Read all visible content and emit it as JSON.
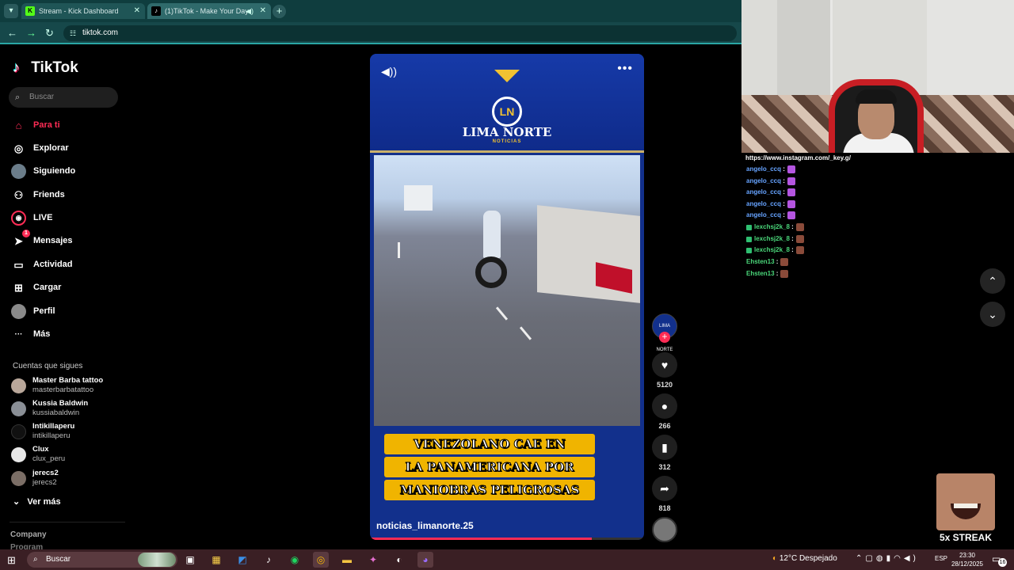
{
  "browser": {
    "tabs": [
      {
        "label": "Stream - Kick Dashboard",
        "favicon": "K"
      },
      {
        "label": "(1)TikTok - Make Your Day",
        "favicon": "♪"
      }
    ],
    "url": "tiktok.com"
  },
  "tiktok": {
    "logo": "TikTok",
    "search_placeholder": "Buscar",
    "nav": [
      {
        "label": "Para ti",
        "icon": "home-icon",
        "glyph": "⌂"
      },
      {
        "label": "Explorar",
        "icon": "compass-icon",
        "glyph": "◎"
      },
      {
        "label": "Siguiendo",
        "icon": "following-avatar-icon",
        "glyph": "●"
      },
      {
        "label": "Friends",
        "icon": "friends-icon",
        "glyph": "⚇"
      },
      {
        "label": "LIVE",
        "icon": "live-icon",
        "glyph": "◉"
      },
      {
        "label": "Mensajes",
        "icon": "messages-icon",
        "glyph": "➤",
        "badge": "1"
      },
      {
        "label": "Actividad",
        "icon": "activity-icon",
        "glyph": "▭"
      },
      {
        "label": "Cargar",
        "icon": "upload-icon",
        "glyph": "⊞"
      },
      {
        "label": "Perfil",
        "icon": "profile-avatar-icon",
        "glyph": "●"
      },
      {
        "label": "Más",
        "icon": "more-icon",
        "glyph": "···"
      }
    ],
    "following_title": "Cuentas que sigues",
    "following": [
      {
        "name": "Master Barba tattoo",
        "handle": "masterbarbatattoo"
      },
      {
        "name": "Kussia Baldwin",
        "handle": "kussiabaldwin"
      },
      {
        "name": "Intikillaperu",
        "handle": "intikillaperu"
      },
      {
        "name": "Clux",
        "handle": "clux_peru"
      },
      {
        "name": "jerecs2",
        "handle": "jerecs2"
      }
    ],
    "see_more": "Ver más",
    "footer_company": "Company",
    "footer_program": "Program"
  },
  "video": {
    "brand": "LIMA NORTE",
    "brand_sub": "NOTICIAS",
    "logo_letters": "LN",
    "caption_lines": [
      "VENEZOLANO CAE EN",
      "LA PANAMERICANA POR",
      "MANIOBRAS PELIGROSAS"
    ],
    "author": "noticias_limanorte.25",
    "progress": 0.81,
    "avatar_text": "LIMA NORTE"
  },
  "actions": {
    "likes": "5120",
    "comments": "266",
    "saves": "312",
    "shares": "818"
  },
  "chat": {
    "url": "https://www.instagram.com/_key.g/",
    "messages": [
      {
        "user": "angelo_ccq",
        "color": "blue"
      },
      {
        "user": "angelo_ccq",
        "color": "blue"
      },
      {
        "user": "angelo_ccq",
        "color": "blue"
      },
      {
        "user": "angelo_ccq",
        "color": "blue"
      },
      {
        "user": "angelo_ccq",
        "color": "blue"
      },
      {
        "user": "lexchsj2k_8",
        "color": "green"
      },
      {
        "user": "lexchsj2k_8",
        "color": "green"
      },
      {
        "user": "lexchsj2k_8",
        "color": "green"
      },
      {
        "user": "Ehsten13",
        "color": "green"
      },
      {
        "user": "Ehsten13",
        "color": "green"
      }
    ],
    "separator": " :"
  },
  "overlay": {
    "streak": "5x STREAK"
  },
  "taskbar": {
    "search_placeholder": "Buscar",
    "weather": "12°C  Despejado",
    "lang": "ESP",
    "time": "23:30",
    "date": "28/12/2025",
    "notif_count": "16"
  },
  "colors": {
    "accent": "#fe2c55",
    "chat_blue": "#66a3ff",
    "chat_green": "#4ad77a",
    "video_blue": "#12308c"
  }
}
